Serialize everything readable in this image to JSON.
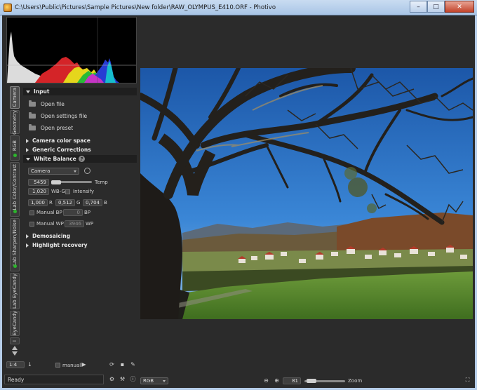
{
  "window": {
    "title": "C:\\Users\\Public\\Pictures\\Sample Pictures\\New folder\\RAW_OLYMPUS_E410.ORF - Photivo",
    "minimize": "–",
    "maximize": "□",
    "close": "✕"
  },
  "tabs": [
    {
      "label": "Camera",
      "active": true,
      "indicator": false
    },
    {
      "label": "Geometry",
      "active": false,
      "indicator": false
    },
    {
      "label": "RGB",
      "active": false,
      "indicator": true
    },
    {
      "label": "Lab Color/Contrast",
      "active": false,
      "indicator": true
    },
    {
      "label": "Lab Sharpen/Noise",
      "active": false,
      "indicator": true
    },
    {
      "label": "Lab EyeCandy",
      "active": false,
      "indicator": false
    },
    {
      "label": "EyeCandy",
      "active": false,
      "indicator": false
    },
    {
      "label": "I",
      "active": false,
      "indicator": false
    }
  ],
  "input": {
    "header": "Input",
    "items": [
      "Open file",
      "Open settings file",
      "Open preset"
    ]
  },
  "sections": {
    "camera_color_space": "Camera color space",
    "generic_corrections": "Generic Corrections",
    "white_balance": "White Balance",
    "demosaicing": "Demosaicing",
    "highlight_recovery": "Highlight recovery"
  },
  "white_balance": {
    "preset": "Camera",
    "temp_value": "5459",
    "temp_label": "Temp",
    "wbg_value": "1,020",
    "wbg_label": "WB-G",
    "intensify_label": "Intensify",
    "r_value": "1,000",
    "r_label": "R",
    "g_value": "0,512",
    "g_label": "G",
    "b_value": "0,704",
    "b_label": "B",
    "manual_bp_label": "Manual BP",
    "bp_value": "0",
    "bp_label": "BP",
    "manual_wp_label": "Manual WP",
    "wp_value": "3946",
    "wp_label": "WP"
  },
  "bottom": {
    "zoom_preset": "1:4",
    "manual_label": "manual",
    "status": "Ready",
    "mode": "RGB",
    "zoom_value": "81",
    "zoom_label": "Zoom"
  },
  "colors": {
    "background": "#2b2b2b",
    "sky": "#2f74c8",
    "grass": "#5a8a2e",
    "indicator": "#2db52d"
  }
}
